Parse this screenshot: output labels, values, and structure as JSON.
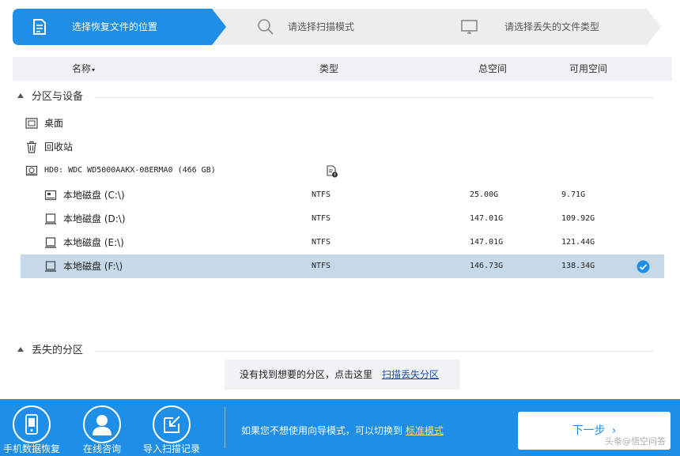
{
  "stepper": {
    "steps": [
      {
        "label": "选择恢复文件的位置",
        "active": true
      },
      {
        "label": "请选择扫描模式",
        "active": false
      },
      {
        "label": "请选择丢失的文件类型",
        "active": false
      }
    ],
    "active_color": "#1f8ee6",
    "inactive_color": "#eeeeee"
  },
  "table_header": {
    "name": "名称",
    "type": "类型",
    "total": "总空间",
    "free": "可用空间"
  },
  "partitions_section": {
    "title": "分区与设备",
    "items": [
      {
        "label": "桌面",
        "icon": "desktop-icon"
      },
      {
        "label": "回收站",
        "icon": "recycle-bin-icon"
      }
    ],
    "disk": {
      "label": "HD0: WDC WD5000AAKX-08ERMA0 (466 GB)",
      "icon": "hard-disk-icon",
      "info_icon": "disk-info-icon"
    },
    "drives": [
      {
        "name": "本地磁盘 (C:\\)",
        "type": "NTFS",
        "total": "25.00G",
        "free": "9.71G",
        "icon": "system-drive-icon",
        "selected": false
      },
      {
        "name": "本地磁盘 (D:\\)",
        "type": "NTFS",
        "total": "147.01G",
        "free": "109.92G",
        "icon": "drive-icon",
        "selected": false
      },
      {
        "name": "本地磁盘 (E:\\)",
        "type": "NTFS",
        "total": "147.01G",
        "free": "121.44G",
        "icon": "drive-icon",
        "selected": false
      },
      {
        "name": "本地磁盘 (F:\\)",
        "type": "NTFS",
        "total": "146.73G",
        "free": "138.34G",
        "icon": "drive-icon",
        "selected": true
      }
    ]
  },
  "lost_section": {
    "title": "丢失的分区",
    "prompt": "没有找到想要的分区，点击这里",
    "link": "扫描丢失分区"
  },
  "bottom_bar": {
    "buttons": [
      {
        "label": "手机数据恢复",
        "icon": "phone-icon"
      },
      {
        "label": "在线咨询",
        "icon": "user-icon"
      },
      {
        "label": "导入扫描记录",
        "icon": "import-icon"
      }
    ],
    "hint": "如果您不想使用向导模式，可以切换到",
    "hint_link": "标准模式",
    "next": "下一步",
    "color": "#1f8ee6",
    "watermark": "头条@悟空问答"
  }
}
